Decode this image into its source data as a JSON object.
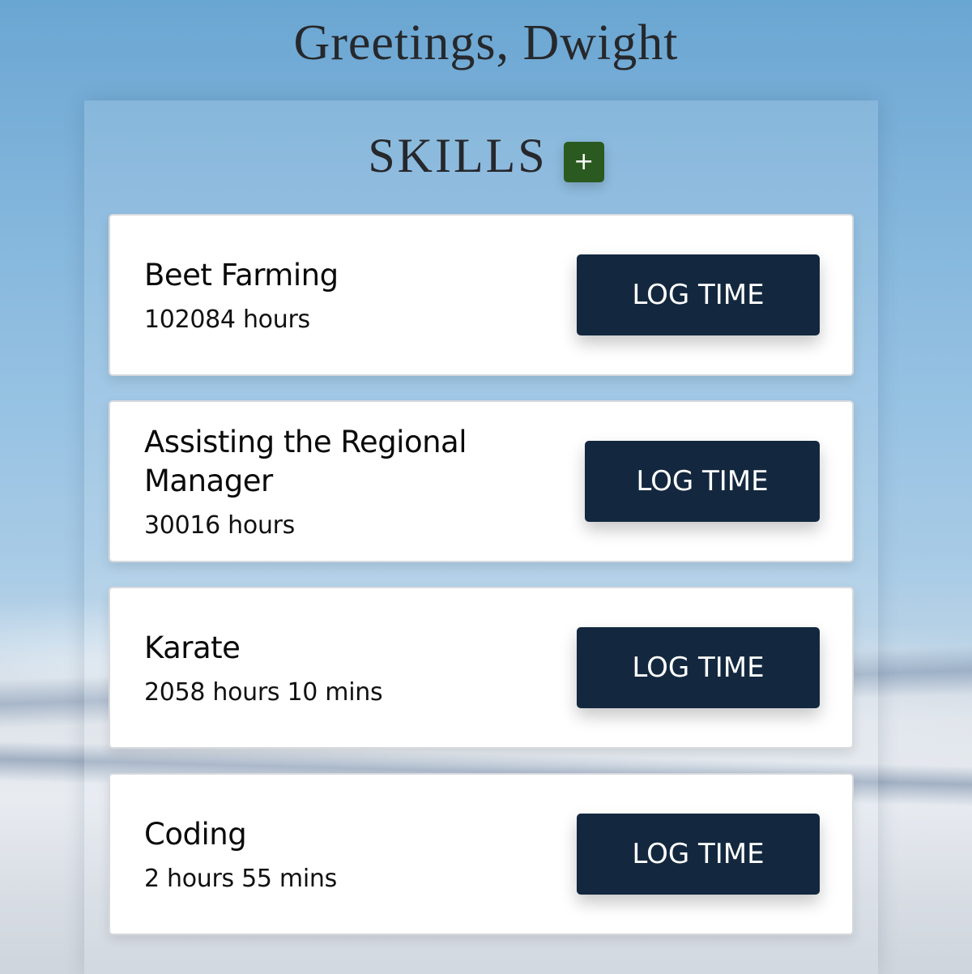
{
  "greeting": "Greetings, Dwight",
  "skills_section": {
    "title": "SKILLS",
    "add_label": "+"
  },
  "skills": [
    {
      "name": "Beet Farming",
      "time": "102084 hours",
      "button_label": "LOG TIME"
    },
    {
      "name": "Assisting the Regional Manager",
      "time": "30016 hours",
      "button_label": "LOG TIME"
    },
    {
      "name": "Karate",
      "time": "2058 hours 10 mins",
      "button_label": "LOG TIME"
    },
    {
      "name": "Coding",
      "time": "2 hours 55 mins",
      "button_label": "LOG TIME"
    }
  ],
  "colors": {
    "button_bg": "#13283f",
    "add_button_bg": "#2a5a1f",
    "heading_text": "#26282c"
  },
  "icons": {
    "add": "plus-icon"
  }
}
